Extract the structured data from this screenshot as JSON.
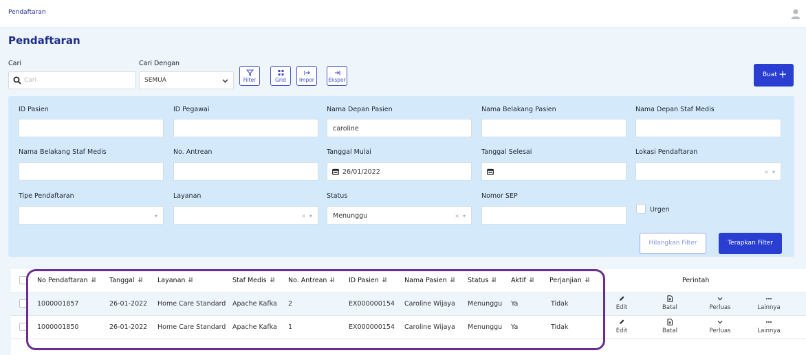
{
  "topbar": {
    "breadcrumb": "Pendaftaran",
    "avatar_icon": "user-icon"
  },
  "page": {
    "title": "Pendaftaran"
  },
  "search": {
    "label": "Cari",
    "placeholder": "Cari",
    "by_label": "Cari Dengan",
    "by_value": "SEMUA"
  },
  "toolbar": {
    "filter": "Filter",
    "grid": "Grid",
    "import": "Impor",
    "export": "Ekspor",
    "create": "Buat"
  },
  "filters": {
    "patient_id": {
      "label": "ID Pasien",
      "value": ""
    },
    "employee_id": {
      "label": "ID Pegawai",
      "value": ""
    },
    "patient_first_name": {
      "label": "Nama Depan Pasien",
      "value": "caroline"
    },
    "patient_last_name": {
      "label": "Nama Belakang Pasien",
      "value": ""
    },
    "staff_first_name": {
      "label": "Nama Depan Staf Medis",
      "value": ""
    },
    "staff_last_name": {
      "label": "Nama Belakang Staf Medis",
      "value": ""
    },
    "queue_no": {
      "label": "No. Antrean",
      "value": ""
    },
    "start_date": {
      "label": "Tanggal Mulai",
      "value": "26/01/2022"
    },
    "end_date": {
      "label": "Tanggal Selesai",
      "value": ""
    },
    "location": {
      "label": "Lokasi Pendaftaran",
      "value": ""
    },
    "reg_type": {
      "label": "Tipe Pendaftaran",
      "value": ""
    },
    "service": {
      "label": "Layanan",
      "value": ""
    },
    "status": {
      "label": "Status",
      "value": "Menunggu"
    },
    "sep_no": {
      "label": "Nomor SEP",
      "value": ""
    },
    "urgent": {
      "label": "Urgen",
      "checked": false
    },
    "clear_btn": "Hilangkan Filter",
    "apply_btn": "Terapkan Filter"
  },
  "table": {
    "columns": [
      "No Pendaftaran",
      "Tanggal",
      "Layanan",
      "Staf Medis",
      "No. Antrean",
      "ID Pasien",
      "Nama Pasien",
      "Status",
      "Aktif",
      "Perjanjian"
    ],
    "commands_header": "Perintah",
    "actions": [
      "Edit",
      "Batal",
      "Perluas",
      "Lainnya"
    ],
    "rows": [
      [
        "1000001857",
        "26-01-2022",
        "Home Care Standard",
        "Apache Kafka",
        "2",
        "EX000000154",
        "Caroline Wijaya",
        "Menunggu",
        "Ya",
        "Tidak"
      ],
      [
        "1000001850",
        "26-01-2022",
        "Home Care Standard",
        "Apache Kafka",
        "1",
        "EX000000154",
        "Caroline Wijaya",
        "Menunggu",
        "Ya",
        "Tidak"
      ]
    ]
  },
  "colors": {
    "primary": "#2a3fd2",
    "title": "#1f2d8a",
    "panel": "#d4eafb",
    "highlight": "#6a2e91"
  }
}
